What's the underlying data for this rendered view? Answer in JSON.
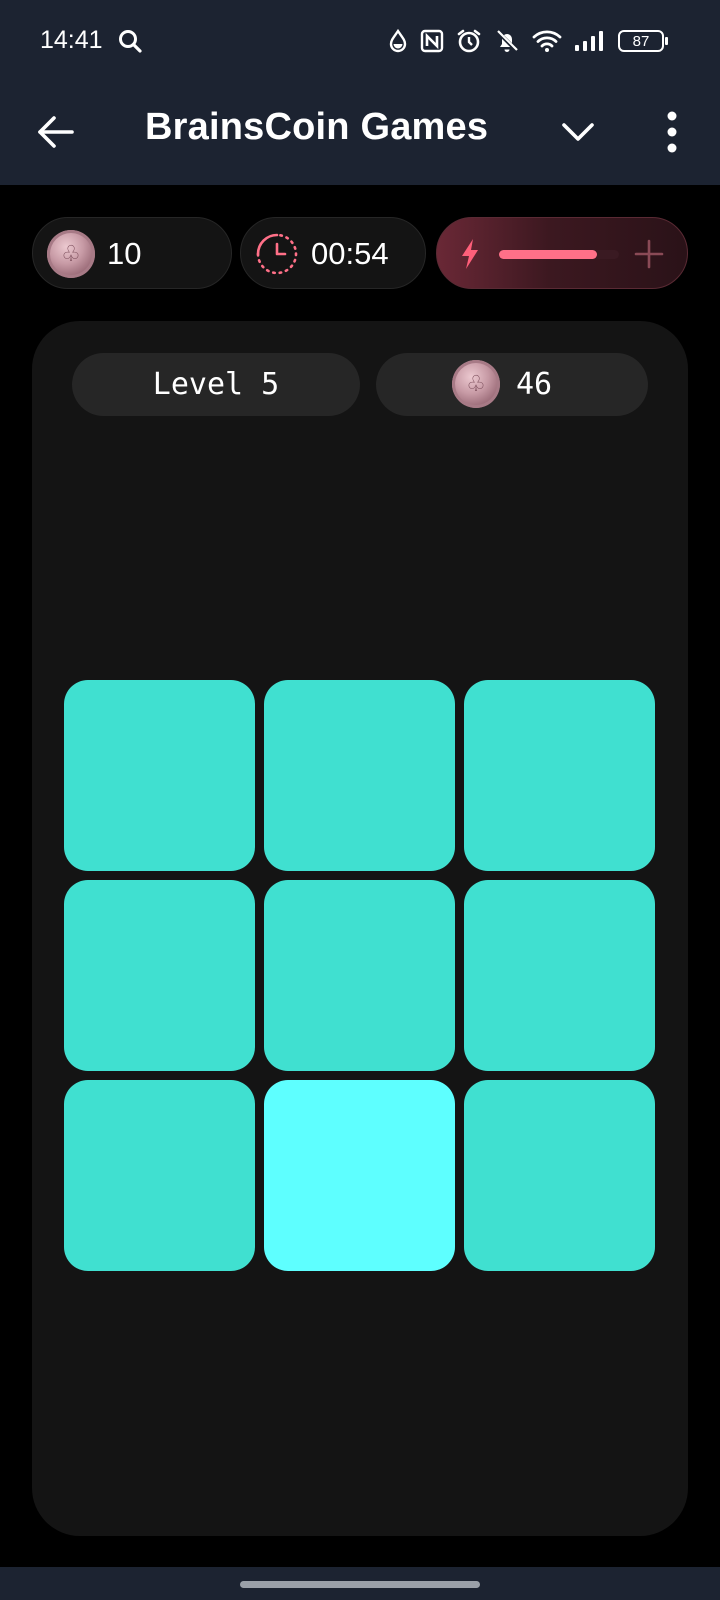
{
  "status_bar": {
    "time": "14:41",
    "battery": "87",
    "icons": [
      "search-icon",
      "data-saver-icon",
      "nfc-icon",
      "alarm-icon",
      "bell-off-icon",
      "wifi-icon",
      "signal-icon",
      "battery-icon"
    ]
  },
  "app_bar": {
    "title": "BrainsCoin Games",
    "icons": [
      "back-arrow-icon",
      "chevron-down-icon",
      "more-vert-icon"
    ]
  },
  "stats": {
    "coins": "10",
    "timer": "00:54",
    "energy_level": 0.82,
    "energy_color": "#ff7088"
  },
  "game": {
    "level_label": "Level 5",
    "score": "46",
    "grid": {
      "rows": 3,
      "cols": 3,
      "tile_color": "#40e0d0",
      "highlight_color": "#5effff",
      "highlighted_tile": 7
    }
  }
}
